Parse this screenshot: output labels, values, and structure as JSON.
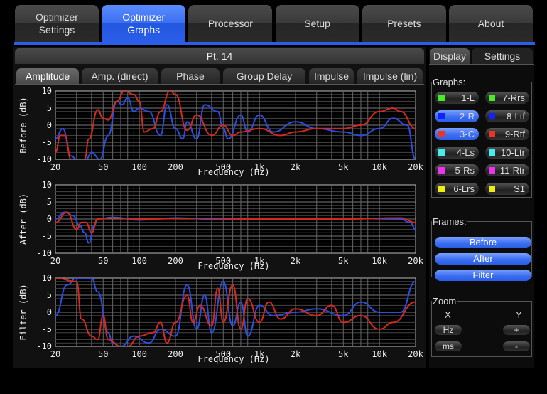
{
  "tabs": [
    "Optimizer\nSettings",
    "Optimizer\nGraphs",
    "Processor",
    "Setup",
    "Presets",
    "About"
  ],
  "active_tab": 1,
  "panel_title": "Pt. 14",
  "subtabs": [
    "Amplitude",
    "Amp. (direct)",
    "Phase",
    "Group Delay",
    "Impulse",
    "Impulse (lin)"
  ],
  "right_tabs": [
    "Display",
    "Settings"
  ],
  "graphs_label": "Graphs:",
  "graph_buttons": [
    {
      "label": "1-L",
      "color": "#44ee22",
      "on": false
    },
    {
      "label": "7-Rrs",
      "color": "#44ee22",
      "on": false
    },
    {
      "label": "2-R",
      "color": "#1122ff",
      "on": true
    },
    {
      "label": "8-Ltf",
      "color": "#1122ff",
      "on": false
    },
    {
      "label": "3-C",
      "color": "#ee3322",
      "on": true
    },
    {
      "label": "9-Rtf",
      "color": "#ee3322",
      "on": false
    },
    {
      "label": "4-Ls",
      "color": "#44eeee",
      "on": false
    },
    {
      "label": "10-Ltr",
      "color": "#44eeee",
      "on": false
    },
    {
      "label": "5-Rs",
      "color": "#ee33ee",
      "on": false
    },
    {
      "label": "11-Rtr",
      "color": "#ee33ee",
      "on": false
    },
    {
      "label": "6-Lrs",
      "color": "#eeee11",
      "on": false
    },
    {
      "label": "S1",
      "color": "#eeee11",
      "on": false
    }
  ],
  "frames_label": "Frames:",
  "frames": [
    "Before",
    "After",
    "Filter"
  ],
  "zoom": {
    "label": "Zoom",
    "x": "X",
    "y": "Y",
    "x_buttons": [
      "Hz",
      "ms"
    ],
    "y_buttons": [
      "+",
      "-"
    ]
  },
  "chart_data": [
    {
      "type": "line",
      "ylabel": "Before (dB)",
      "xlabel": "Frequency (Hz)",
      "ylim": [
        -10,
        10
      ],
      "xlim": [
        20,
        20000
      ],
      "xscale": "log",
      "yticks": [
        "10",
        "5",
        "0",
        "-5",
        "-10"
      ],
      "xticks": [
        [
          20,
          "20"
        ],
        [
          50,
          "50"
        ],
        [
          100,
          "100"
        ],
        [
          200,
          "200"
        ],
        [
          500,
          "500"
        ],
        [
          1000,
          "1k"
        ],
        [
          2000,
          "2k"
        ],
        [
          5000,
          "5k"
        ],
        [
          10000,
          "10k"
        ],
        [
          20000,
          "20k"
        ]
      ],
      "series": [
        {
          "name": "2-R",
          "color": "#2a4fe0",
          "points": [
            [
              20,
              -4
            ],
            [
              23,
              -1
            ],
            [
              27,
              -9
            ],
            [
              30,
              -10
            ],
            [
              36,
              -10
            ],
            [
              40,
              -8
            ],
            [
              47,
              -10
            ],
            [
              55,
              -3
            ],
            [
              65,
              7
            ],
            [
              72,
              6
            ],
            [
              80,
              8
            ],
            [
              90,
              4
            ],
            [
              100,
              5
            ],
            [
              120,
              4
            ],
            [
              150,
              -3
            ],
            [
              170,
              6
            ],
            [
              200,
              -1
            ],
            [
              230,
              -4
            ],
            [
              250,
              1
            ],
            [
              300,
              -4
            ],
            [
              350,
              6
            ],
            [
              450,
              4
            ],
            [
              500,
              -1
            ],
            [
              550,
              -4
            ],
            [
              700,
              3
            ],
            [
              800,
              -2
            ],
            [
              1000,
              3
            ],
            [
              1300,
              -2
            ],
            [
              2000,
              1
            ],
            [
              3000,
              -1
            ],
            [
              5000,
              -2
            ],
            [
              7000,
              -3
            ],
            [
              10000,
              -1
            ],
            [
              13000,
              2
            ],
            [
              17000,
              0
            ],
            [
              20000,
              -10
            ]
          ]
        },
        {
          "name": "3-C",
          "color": "#d42a1e",
          "points": [
            [
              20,
              -8
            ],
            [
              22,
              -3
            ],
            [
              24,
              -3
            ],
            [
              27,
              -10
            ],
            [
              35,
              -10
            ],
            [
              38,
              -4
            ],
            [
              45,
              4.5
            ],
            [
              50,
              2
            ],
            [
              55,
              1.5
            ],
            [
              65,
              7
            ],
            [
              75,
              10
            ],
            [
              90,
              9
            ],
            [
              100,
              7
            ],
            [
              110,
              -2
            ],
            [
              130,
              -1
            ],
            [
              150,
              4
            ],
            [
              180,
              10
            ],
            [
              200,
              9
            ],
            [
              250,
              -1.5
            ],
            [
              300,
              3
            ],
            [
              400,
              -3
            ],
            [
              500,
              0
            ],
            [
              600,
              -3
            ],
            [
              700,
              -2
            ],
            [
              1000,
              -1
            ],
            [
              1500,
              -3
            ],
            [
              2000,
              -2
            ],
            [
              3000,
              -1
            ],
            [
              5000,
              -1
            ],
            [
              7000,
              0
            ],
            [
              10000,
              4
            ],
            [
              13000,
              5
            ],
            [
              15000,
              4
            ],
            [
              20000,
              -1
            ]
          ]
        }
      ]
    },
    {
      "type": "line",
      "ylabel": "After (dB)",
      "xlabel": "Frequency (Hz)",
      "ylim": [
        -10,
        10
      ],
      "xlim": [
        20,
        20000
      ],
      "xscale": "log",
      "yticks": [
        "10",
        "5",
        "0",
        "-5",
        "-10"
      ],
      "xticks": [
        [
          20,
          "20"
        ],
        [
          50,
          "50"
        ],
        [
          100,
          "100"
        ],
        [
          200,
          "200"
        ],
        [
          500,
          "500"
        ],
        [
          1000,
          "1k"
        ],
        [
          2000,
          "2k"
        ],
        [
          5000,
          "5k"
        ],
        [
          10000,
          "10k"
        ],
        [
          20000,
          "20k"
        ]
      ],
      "series": [
        {
          "name": "2-R",
          "color": "#2a4fe0",
          "points": [
            [
              20,
              0
            ],
            [
              24,
              2
            ],
            [
              28,
              1
            ],
            [
              32,
              -2
            ],
            [
              35,
              -4
            ],
            [
              38,
              -7
            ],
            [
              42,
              -2
            ],
            [
              45,
              0
            ],
            [
              60,
              0.5
            ],
            [
              100,
              -0.3
            ],
            [
              200,
              0.3
            ],
            [
              500,
              -0.2
            ],
            [
              1000,
              0
            ],
            [
              5000,
              0.2
            ],
            [
              15000,
              0
            ],
            [
              18000,
              -1
            ],
            [
              20000,
              -3
            ]
          ]
        },
        {
          "name": "3-C",
          "color": "#d42a1e",
          "points": [
            [
              20,
              -1
            ],
            [
              25,
              2
            ],
            [
              30,
              -3
            ],
            [
              33,
              -1
            ],
            [
              36,
              -1
            ],
            [
              40,
              -4
            ],
            [
              45,
              0
            ],
            [
              60,
              0.3
            ],
            [
              100,
              0
            ],
            [
              300,
              0.2
            ],
            [
              1000,
              0
            ],
            [
              5000,
              0
            ],
            [
              15000,
              0.3
            ],
            [
              20000,
              -1
            ]
          ]
        }
      ]
    },
    {
      "type": "line",
      "ylabel": "Filter (dB)",
      "xlabel": "Frequency (Hz)",
      "ylim": [
        -10,
        10
      ],
      "xlim": [
        20,
        20000
      ],
      "xscale": "log",
      "yticks": [
        "10",
        "5",
        "0",
        "-5",
        "-10"
      ],
      "xticks": [
        [
          20,
          "20"
        ],
        [
          50,
          "50"
        ],
        [
          100,
          "100"
        ],
        [
          200,
          "200"
        ],
        [
          500,
          "500"
        ],
        [
          1000,
          "1k"
        ],
        [
          2000,
          "2k"
        ],
        [
          5000,
          "5k"
        ],
        [
          10000,
          "10k"
        ],
        [
          20000,
          "20k"
        ]
      ],
      "series": [
        {
          "name": "2-R",
          "color": "#2a4fe0",
          "points": [
            [
              20,
              -1
            ],
            [
              25,
              8
            ],
            [
              30,
              10
            ],
            [
              40,
              10
            ],
            [
              45,
              6
            ],
            [
              55,
              -6
            ],
            [
              60,
              -9
            ],
            [
              70,
              -10
            ],
            [
              90,
              -7
            ],
            [
              120,
              -9
            ],
            [
              150,
              -5
            ],
            [
              200,
              -7
            ],
            [
              250,
              8
            ],
            [
              300,
              -5
            ],
            [
              350,
              5
            ],
            [
              400,
              -6
            ],
            [
              500,
              9
            ],
            [
              600,
              -4
            ],
            [
              700,
              3
            ],
            [
              800,
              -7
            ],
            [
              1000,
              2
            ],
            [
              1300,
              -1
            ],
            [
              2000,
              0
            ],
            [
              3000,
              1
            ],
            [
              5000,
              -1
            ],
            [
              7000,
              3
            ],
            [
              10000,
              0
            ],
            [
              15000,
              0
            ],
            [
              20000,
              9
            ]
          ]
        },
        {
          "name": "3-C",
          "color": "#d42a1e",
          "points": [
            [
              20,
              10
            ],
            [
              30,
              9
            ],
            [
              33,
              -2
            ],
            [
              40,
              -7
            ],
            [
              45,
              -8
            ],
            [
              50,
              -1
            ],
            [
              55,
              -8
            ],
            [
              70,
              -10
            ],
            [
              80,
              -10
            ],
            [
              100,
              -7
            ],
            [
              130,
              -6
            ],
            [
              150,
              -3
            ],
            [
              170,
              -9
            ],
            [
              200,
              -3
            ],
            [
              250,
              5
            ],
            [
              280,
              -3
            ],
            [
              320,
              2
            ],
            [
              400,
              -4
            ],
            [
              450,
              7
            ],
            [
              500,
              -3
            ],
            [
              600,
              8
            ],
            [
              700,
              -5
            ],
            [
              800,
              4
            ],
            [
              1000,
              -3
            ],
            [
              1200,
              3
            ],
            [
              1500,
              -2
            ],
            [
              2000,
              1
            ],
            [
              3000,
              -1
            ],
            [
              4000,
              2
            ],
            [
              5000,
              -3
            ],
            [
              7000,
              -1
            ],
            [
              10000,
              -5
            ],
            [
              13000,
              -3
            ],
            [
              20000,
              3
            ]
          ]
        }
      ]
    }
  ]
}
